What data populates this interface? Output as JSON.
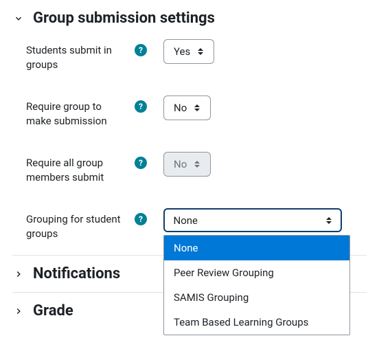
{
  "section": {
    "title": "Group submission settings",
    "fields": {
      "submitInGroups": {
        "label": "Students submit in groups",
        "value": "Yes"
      },
      "requireGroup": {
        "label": "Require group to make submission",
        "value": "No"
      },
      "requireAllMembers": {
        "label": "Require all group members submit",
        "value": "No"
      },
      "grouping": {
        "label": "Grouping for student groups",
        "value": "None"
      }
    },
    "groupingOptions": [
      "None",
      "Peer Review Grouping",
      "SAMIS Grouping",
      "Team Based Learning Groups"
    ]
  },
  "collapsed": {
    "notifications": "Notifications",
    "grade": "Grade"
  }
}
